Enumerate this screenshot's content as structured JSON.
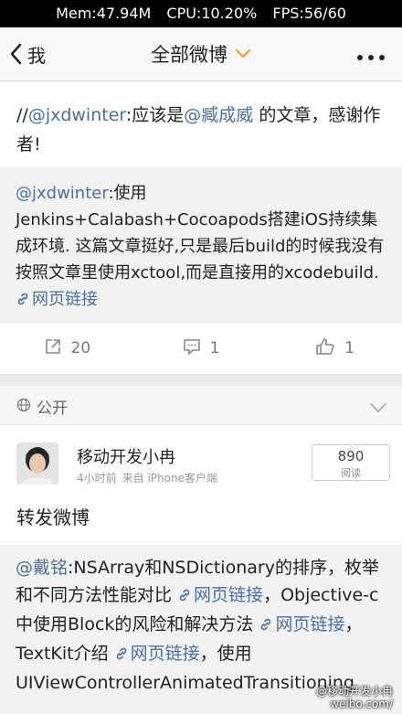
{
  "status_bar": {
    "mem": "Mem:47.94M",
    "cpu": "CPU:10.20%",
    "fps": "FPS:56/60"
  },
  "nav": {
    "back_label": "我",
    "title": "全部微博"
  },
  "post1": {
    "prefix": "//",
    "mention": "@jxdwinter",
    "text_a": ":应该是",
    "mention2": "@臧成威",
    "text_b": " 的文章，感谢作者!"
  },
  "forward1": {
    "mention": "@jxdwinter",
    "text": ":使用Jenkins+Calabash+Cocoapods搭建iOS持续集成环境. 这篇文章挺好,只是最后build的时候我没有按照文章里使用xctool,而是直接用的xcodebuild. ",
    "link": "网页链接"
  },
  "actions": {
    "repost_count": "20",
    "comment_count": "1",
    "like_count": "1"
  },
  "visibility": {
    "label": "公开"
  },
  "post2": {
    "username": "移动开发小冉",
    "time": "4小时前",
    "source": "来自 iPhone客户端",
    "read_count": "890",
    "read_label": "阅读",
    "text": "转发微博"
  },
  "forward2": {
    "mention": "@戴铭",
    "text_a": ":NSArray和NSDictionary的排序，枚举和不同方法性能对比 ",
    "link1": "网页链接",
    "text_b": "，Objective-c中使用Block的风险和解决方法 ",
    "link2": "网页链接",
    "text_c": "，TextKit介绍 ",
    "link3": "网页链接",
    "text_d": "，使用UIViewControllerAnimatedTransitioning",
    "watermark": "@移动开发小冉\nweibo.com/"
  },
  "colors": {
    "link": "#4a6fa5",
    "accent": "#f0a030",
    "bg_forward": "#f2f2f2"
  }
}
